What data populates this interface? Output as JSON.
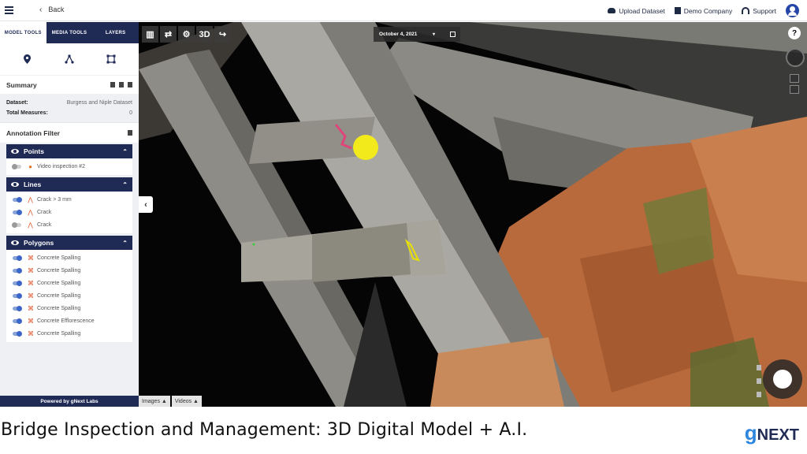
{
  "topbar": {
    "back_label": "Back",
    "upload_label": "Upload Dataset",
    "company_label": "Demo Company",
    "support_label": "Support"
  },
  "sidebar": {
    "tabs": [
      {
        "label": "MODEL TOOLS",
        "active": true
      },
      {
        "label": "MEDIA TOOLS",
        "active": false
      },
      {
        "label": "LAYERS",
        "active": false
      }
    ],
    "tools": [
      "pin-icon",
      "line-tool-icon",
      "polygon-tool-icon"
    ],
    "summary_title": "Summary",
    "dataset_label": "Dataset:",
    "dataset_value": "Burgess and Niple Dataset",
    "measures_label": "Total Measures:",
    "measures_value": "0",
    "filter_title": "Annotation Filter",
    "groups": [
      {
        "title": "Points",
        "items": [
          {
            "label": "Video inspection #2",
            "toggle": "off",
            "glyph": "pin"
          }
        ]
      },
      {
        "title": "Lines",
        "items": [
          {
            "label": "Crack > 3 mm",
            "toggle": "on",
            "glyph": "line"
          },
          {
            "label": "Crack",
            "toggle": "on",
            "glyph": "line"
          },
          {
            "label": "Crack",
            "toggle": "off",
            "glyph": "line"
          }
        ]
      },
      {
        "title": "Polygons",
        "items": [
          {
            "label": "Concrete Spalling",
            "toggle": "on",
            "glyph": "poly"
          },
          {
            "label": "Concrete Spalling",
            "toggle": "on",
            "glyph": "poly"
          },
          {
            "label": "Concrete Spalling",
            "toggle": "on",
            "glyph": "poly"
          },
          {
            "label": "Concrete Spalling",
            "toggle": "on",
            "glyph": "poly"
          },
          {
            "label": "Concrete Spalling",
            "toggle": "on",
            "glyph": "poly"
          },
          {
            "label": "Concrete Efflorescence",
            "toggle": "on",
            "glyph": "poly"
          },
          {
            "label": "Concrete Spalling",
            "toggle": "on",
            "glyph": "poly"
          }
        ]
      }
    ],
    "powered_label": "Powered by gNext Labs"
  },
  "viewer": {
    "toolbar": [
      "split-view-icon",
      "swap-icon",
      "gear-icon",
      "3D",
      "share-icon"
    ],
    "date_label": "October 4, 2021",
    "help_label": "?",
    "media_tabs": [
      "Images ▲",
      "Videos ▲"
    ]
  },
  "caption": {
    "text": "Bridge Inspection and Management: 3D Digital Model + A.I.",
    "logo_g": "g",
    "logo_rest": "NEXT"
  },
  "colors": {
    "navy": "#1f2a55",
    "accent_blue": "#3c66c8",
    "sandstone": "#b86a3c",
    "concrete": "#b9b9b4",
    "marker_yellow": "#f2ea1a"
  }
}
